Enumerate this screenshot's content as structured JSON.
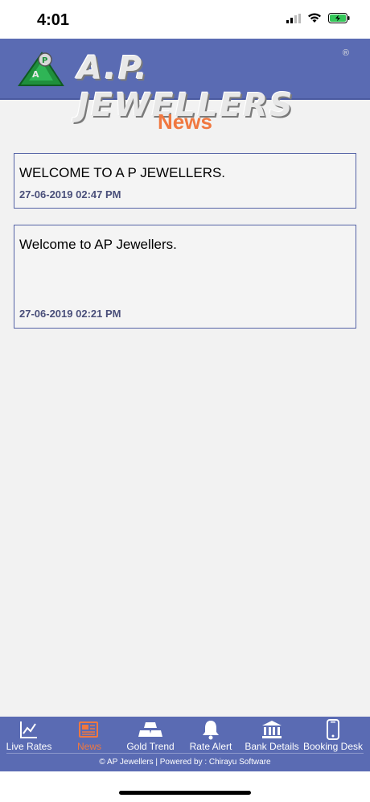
{
  "status": {
    "time": "4:01"
  },
  "header": {
    "brand": "A.P. JEWELLERS",
    "reg_mark": "®"
  },
  "page": {
    "title": "News"
  },
  "news": [
    {
      "text": "WELCOME TO A P JEWELLERS.",
      "date": "27-06-2019 02:47 PM"
    },
    {
      "text": "Welcome to AP Jewellers.",
      "date": "27-06-2019 02:21 PM"
    }
  ],
  "tabs": [
    {
      "label": "Live Rates",
      "icon": "chart-icon"
    },
    {
      "label": "News",
      "icon": "newspaper-icon"
    },
    {
      "label": "Gold Trend",
      "icon": "gold-bars-icon"
    },
    {
      "label": "Rate Alert",
      "icon": "bell-icon"
    },
    {
      "label": "Bank Details",
      "icon": "bank-icon"
    },
    {
      "label": "Booking Desk",
      "icon": "phone-icon"
    }
  ],
  "footer": {
    "text": "© AP Jewellers |  Powered by : Chirayu Software"
  },
  "colors": {
    "header": "#5a6bb3",
    "accent": "#f07840",
    "card_border": "#5563a6"
  }
}
